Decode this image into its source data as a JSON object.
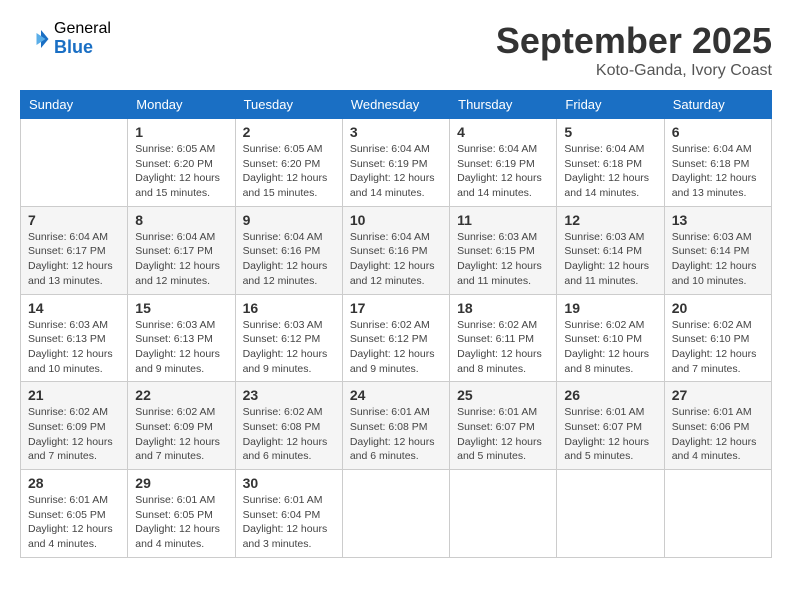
{
  "header": {
    "logo_general": "General",
    "logo_blue": "Blue",
    "month": "September 2025",
    "location": "Koto-Ganda, Ivory Coast"
  },
  "weekdays": [
    "Sunday",
    "Monday",
    "Tuesday",
    "Wednesday",
    "Thursday",
    "Friday",
    "Saturday"
  ],
  "weeks": [
    [
      {
        "day": "",
        "info": ""
      },
      {
        "day": "1",
        "info": "Sunrise: 6:05 AM\nSunset: 6:20 PM\nDaylight: 12 hours\nand 15 minutes."
      },
      {
        "day": "2",
        "info": "Sunrise: 6:05 AM\nSunset: 6:20 PM\nDaylight: 12 hours\nand 15 minutes."
      },
      {
        "day": "3",
        "info": "Sunrise: 6:04 AM\nSunset: 6:19 PM\nDaylight: 12 hours\nand 14 minutes."
      },
      {
        "day": "4",
        "info": "Sunrise: 6:04 AM\nSunset: 6:19 PM\nDaylight: 12 hours\nand 14 minutes."
      },
      {
        "day": "5",
        "info": "Sunrise: 6:04 AM\nSunset: 6:18 PM\nDaylight: 12 hours\nand 14 minutes."
      },
      {
        "day": "6",
        "info": "Sunrise: 6:04 AM\nSunset: 6:18 PM\nDaylight: 12 hours\nand 13 minutes."
      }
    ],
    [
      {
        "day": "7",
        "info": "Sunrise: 6:04 AM\nSunset: 6:17 PM\nDaylight: 12 hours\nand 13 minutes."
      },
      {
        "day": "8",
        "info": "Sunrise: 6:04 AM\nSunset: 6:17 PM\nDaylight: 12 hours\nand 12 minutes."
      },
      {
        "day": "9",
        "info": "Sunrise: 6:04 AM\nSunset: 6:16 PM\nDaylight: 12 hours\nand 12 minutes."
      },
      {
        "day": "10",
        "info": "Sunrise: 6:04 AM\nSunset: 6:16 PM\nDaylight: 12 hours\nand 12 minutes."
      },
      {
        "day": "11",
        "info": "Sunrise: 6:03 AM\nSunset: 6:15 PM\nDaylight: 12 hours\nand 11 minutes."
      },
      {
        "day": "12",
        "info": "Sunrise: 6:03 AM\nSunset: 6:14 PM\nDaylight: 12 hours\nand 11 minutes."
      },
      {
        "day": "13",
        "info": "Sunrise: 6:03 AM\nSunset: 6:14 PM\nDaylight: 12 hours\nand 10 minutes."
      }
    ],
    [
      {
        "day": "14",
        "info": "Sunrise: 6:03 AM\nSunset: 6:13 PM\nDaylight: 12 hours\nand 10 minutes."
      },
      {
        "day": "15",
        "info": "Sunrise: 6:03 AM\nSunset: 6:13 PM\nDaylight: 12 hours\nand 9 minutes."
      },
      {
        "day": "16",
        "info": "Sunrise: 6:03 AM\nSunset: 6:12 PM\nDaylight: 12 hours\nand 9 minutes."
      },
      {
        "day": "17",
        "info": "Sunrise: 6:02 AM\nSunset: 6:12 PM\nDaylight: 12 hours\nand 9 minutes."
      },
      {
        "day": "18",
        "info": "Sunrise: 6:02 AM\nSunset: 6:11 PM\nDaylight: 12 hours\nand 8 minutes."
      },
      {
        "day": "19",
        "info": "Sunrise: 6:02 AM\nSunset: 6:10 PM\nDaylight: 12 hours\nand 8 minutes."
      },
      {
        "day": "20",
        "info": "Sunrise: 6:02 AM\nSunset: 6:10 PM\nDaylight: 12 hours\nand 7 minutes."
      }
    ],
    [
      {
        "day": "21",
        "info": "Sunrise: 6:02 AM\nSunset: 6:09 PM\nDaylight: 12 hours\nand 7 minutes."
      },
      {
        "day": "22",
        "info": "Sunrise: 6:02 AM\nSunset: 6:09 PM\nDaylight: 12 hours\nand 7 minutes."
      },
      {
        "day": "23",
        "info": "Sunrise: 6:02 AM\nSunset: 6:08 PM\nDaylight: 12 hours\nand 6 minutes."
      },
      {
        "day": "24",
        "info": "Sunrise: 6:01 AM\nSunset: 6:08 PM\nDaylight: 12 hours\nand 6 minutes."
      },
      {
        "day": "25",
        "info": "Sunrise: 6:01 AM\nSunset: 6:07 PM\nDaylight: 12 hours\nand 5 minutes."
      },
      {
        "day": "26",
        "info": "Sunrise: 6:01 AM\nSunset: 6:07 PM\nDaylight: 12 hours\nand 5 minutes."
      },
      {
        "day": "27",
        "info": "Sunrise: 6:01 AM\nSunset: 6:06 PM\nDaylight: 12 hours\nand 4 minutes."
      }
    ],
    [
      {
        "day": "28",
        "info": "Sunrise: 6:01 AM\nSunset: 6:05 PM\nDaylight: 12 hours\nand 4 minutes."
      },
      {
        "day": "29",
        "info": "Sunrise: 6:01 AM\nSunset: 6:05 PM\nDaylight: 12 hours\nand 4 minutes."
      },
      {
        "day": "30",
        "info": "Sunrise: 6:01 AM\nSunset: 6:04 PM\nDaylight: 12 hours\nand 3 minutes."
      },
      {
        "day": "",
        "info": ""
      },
      {
        "day": "",
        "info": ""
      },
      {
        "day": "",
        "info": ""
      },
      {
        "day": "",
        "info": ""
      }
    ]
  ]
}
